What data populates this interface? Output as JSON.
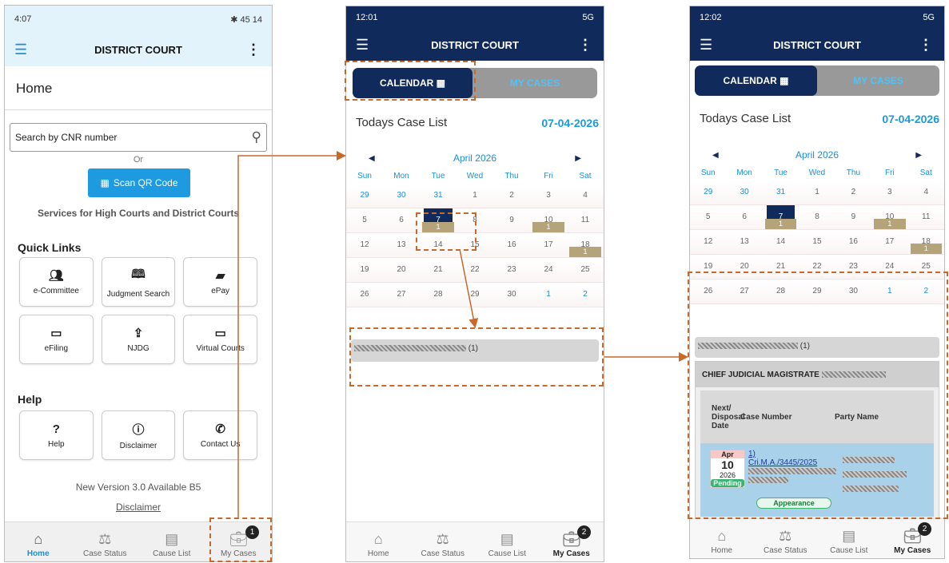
{
  "screen1": {
    "status_time": "4:07",
    "status_right": "✱ 45 14",
    "app_title": "DISTRICT COURT",
    "page_title": "Home",
    "search_placeholder": "Search by CNR number",
    "or_text": "Or",
    "qr_button": "Scan QR Code",
    "services_text": "Services for High Courts and District Courts",
    "quick_links_title": "Quick Links",
    "quick_links": [
      {
        "label": "e-Committee",
        "icon": "people-icon"
      },
      {
        "label": "Judgment Search",
        "icon": "book-icon"
      },
      {
        "label": "ePay",
        "icon": "wallet-icon"
      },
      {
        "label": "eFiling",
        "icon": "window-icon"
      },
      {
        "label": "NJDG",
        "icon": "upload-icon"
      },
      {
        "label": "Virtual Courts",
        "icon": "laptop-icon"
      }
    ],
    "help_title": "Help",
    "help_links": [
      {
        "label": "Help",
        "icon": "question-icon"
      },
      {
        "label": "Disclaimer",
        "icon": "info-icon"
      },
      {
        "label": "Contact Us",
        "icon": "phone-icon"
      }
    ],
    "version_text": "New Version 3.0 Available B5",
    "disclaimer_link": "Disclaimer",
    "nav": {
      "home": "Home",
      "case_status": "Case Status",
      "cause_list": "Cause List",
      "my_cases": "My Cases",
      "badge": "1"
    }
  },
  "screen2": {
    "status_time": "12:01",
    "status_right": "5G",
    "app_title": "DISTRICT COURT",
    "calendar_tab": "CALENDAR",
    "mycases_tab": "MY CASES",
    "todays": "Todays Case List",
    "date": "07-04-2026",
    "month": "April 2026",
    "days": [
      "Sun",
      "Mon",
      "Tue",
      "Wed",
      "Thu",
      "Fri",
      "Sat"
    ],
    "weeks": [
      [
        "29",
        "30",
        "31",
        "1",
        "2",
        "3",
        "4"
      ],
      [
        "5",
        "6",
        "7",
        "8",
        "9",
        "10",
        "11"
      ],
      [
        "12",
        "13",
        "14",
        "15",
        "16",
        "17",
        "18"
      ],
      [
        "19",
        "20",
        "21",
        "22",
        "23",
        "24",
        "25"
      ],
      [
        "26",
        "27",
        "28",
        "29",
        "30",
        "1",
        "2"
      ]
    ],
    "counts": {
      "7": "1",
      "10": "1",
      "18": "1"
    },
    "section_suffix": "(1)",
    "nav": {
      "home": "Home",
      "case_status": "Case Status",
      "cause_list": "Cause List",
      "my_cases": "My Cases",
      "badge": "2"
    }
  },
  "screen3": {
    "status_time": "12:02",
    "status_right": "5G",
    "app_title": "DISTRICT COURT",
    "calendar_tab": "CALENDAR",
    "mycases_tab": "MY CASES",
    "todays": "Todays Case List",
    "date": "07-04-2026",
    "month": "April 2026",
    "section_suffix": "(1)",
    "court_title": "CHIEF JUDICIAL MAGISTRATE",
    "col_date": "Next/ Disposal Date",
    "col_case": "Case Number",
    "col_party": "Party Name",
    "case_month": "Apr",
    "case_day": "10",
    "case_year": "2026",
    "case_status": "Pending",
    "case_index": "1)",
    "case_number": "Cri.M.A./3445/2025",
    "case_purpose": "Appearance",
    "nav": {
      "home": "Home",
      "case_status": "Case Status",
      "cause_list": "Cause List",
      "my_cases": "My Cases",
      "badge": "2"
    }
  },
  "colors": {
    "navy": "#102a5c",
    "accent": "#1b8fd8",
    "annotation": "#c8692a",
    "count": "#b5a37a"
  }
}
